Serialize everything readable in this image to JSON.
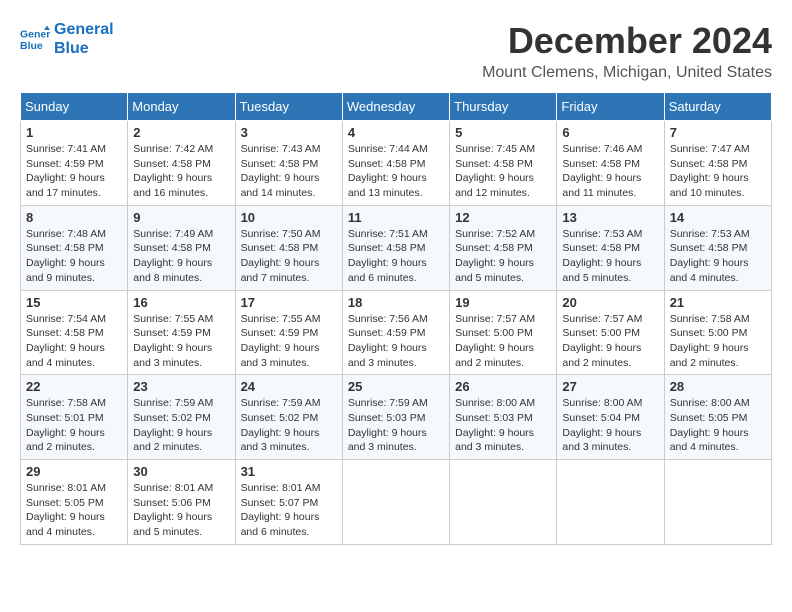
{
  "header": {
    "logo_line1": "General",
    "logo_line2": "Blue",
    "title": "December 2024",
    "subtitle": "Mount Clemens, Michigan, United States"
  },
  "days_of_week": [
    "Sunday",
    "Monday",
    "Tuesday",
    "Wednesday",
    "Thursday",
    "Friday",
    "Saturday"
  ],
  "weeks": [
    [
      {
        "day": "1",
        "info": "Sunrise: 7:41 AM\nSunset: 4:59 PM\nDaylight: 9 hours and 17 minutes."
      },
      {
        "day": "2",
        "info": "Sunrise: 7:42 AM\nSunset: 4:58 PM\nDaylight: 9 hours and 16 minutes."
      },
      {
        "day": "3",
        "info": "Sunrise: 7:43 AM\nSunset: 4:58 PM\nDaylight: 9 hours and 14 minutes."
      },
      {
        "day": "4",
        "info": "Sunrise: 7:44 AM\nSunset: 4:58 PM\nDaylight: 9 hours and 13 minutes."
      },
      {
        "day": "5",
        "info": "Sunrise: 7:45 AM\nSunset: 4:58 PM\nDaylight: 9 hours and 12 minutes."
      },
      {
        "day": "6",
        "info": "Sunrise: 7:46 AM\nSunset: 4:58 PM\nDaylight: 9 hours and 11 minutes."
      },
      {
        "day": "7",
        "info": "Sunrise: 7:47 AM\nSunset: 4:58 PM\nDaylight: 9 hours and 10 minutes."
      }
    ],
    [
      {
        "day": "8",
        "info": "Sunrise: 7:48 AM\nSunset: 4:58 PM\nDaylight: 9 hours and 9 minutes."
      },
      {
        "day": "9",
        "info": "Sunrise: 7:49 AM\nSunset: 4:58 PM\nDaylight: 9 hours and 8 minutes."
      },
      {
        "day": "10",
        "info": "Sunrise: 7:50 AM\nSunset: 4:58 PM\nDaylight: 9 hours and 7 minutes."
      },
      {
        "day": "11",
        "info": "Sunrise: 7:51 AM\nSunset: 4:58 PM\nDaylight: 9 hours and 6 minutes."
      },
      {
        "day": "12",
        "info": "Sunrise: 7:52 AM\nSunset: 4:58 PM\nDaylight: 9 hours and 5 minutes."
      },
      {
        "day": "13",
        "info": "Sunrise: 7:53 AM\nSunset: 4:58 PM\nDaylight: 9 hours and 5 minutes."
      },
      {
        "day": "14",
        "info": "Sunrise: 7:53 AM\nSunset: 4:58 PM\nDaylight: 9 hours and 4 minutes."
      }
    ],
    [
      {
        "day": "15",
        "info": "Sunrise: 7:54 AM\nSunset: 4:58 PM\nDaylight: 9 hours and 4 minutes."
      },
      {
        "day": "16",
        "info": "Sunrise: 7:55 AM\nSunset: 4:59 PM\nDaylight: 9 hours and 3 minutes."
      },
      {
        "day": "17",
        "info": "Sunrise: 7:55 AM\nSunset: 4:59 PM\nDaylight: 9 hours and 3 minutes."
      },
      {
        "day": "18",
        "info": "Sunrise: 7:56 AM\nSunset: 4:59 PM\nDaylight: 9 hours and 3 minutes."
      },
      {
        "day": "19",
        "info": "Sunrise: 7:57 AM\nSunset: 5:00 PM\nDaylight: 9 hours and 2 minutes."
      },
      {
        "day": "20",
        "info": "Sunrise: 7:57 AM\nSunset: 5:00 PM\nDaylight: 9 hours and 2 minutes."
      },
      {
        "day": "21",
        "info": "Sunrise: 7:58 AM\nSunset: 5:00 PM\nDaylight: 9 hours and 2 minutes."
      }
    ],
    [
      {
        "day": "22",
        "info": "Sunrise: 7:58 AM\nSunset: 5:01 PM\nDaylight: 9 hours and 2 minutes."
      },
      {
        "day": "23",
        "info": "Sunrise: 7:59 AM\nSunset: 5:02 PM\nDaylight: 9 hours and 2 minutes."
      },
      {
        "day": "24",
        "info": "Sunrise: 7:59 AM\nSunset: 5:02 PM\nDaylight: 9 hours and 3 minutes."
      },
      {
        "day": "25",
        "info": "Sunrise: 7:59 AM\nSunset: 5:03 PM\nDaylight: 9 hours and 3 minutes."
      },
      {
        "day": "26",
        "info": "Sunrise: 8:00 AM\nSunset: 5:03 PM\nDaylight: 9 hours and 3 minutes."
      },
      {
        "day": "27",
        "info": "Sunrise: 8:00 AM\nSunset: 5:04 PM\nDaylight: 9 hours and 3 minutes."
      },
      {
        "day": "28",
        "info": "Sunrise: 8:00 AM\nSunset: 5:05 PM\nDaylight: 9 hours and 4 minutes."
      }
    ],
    [
      {
        "day": "29",
        "info": "Sunrise: 8:01 AM\nSunset: 5:05 PM\nDaylight: 9 hours and 4 minutes."
      },
      {
        "day": "30",
        "info": "Sunrise: 8:01 AM\nSunset: 5:06 PM\nDaylight: 9 hours and 5 minutes."
      },
      {
        "day": "31",
        "info": "Sunrise: 8:01 AM\nSunset: 5:07 PM\nDaylight: 9 hours and 6 minutes."
      },
      null,
      null,
      null,
      null
    ]
  ]
}
